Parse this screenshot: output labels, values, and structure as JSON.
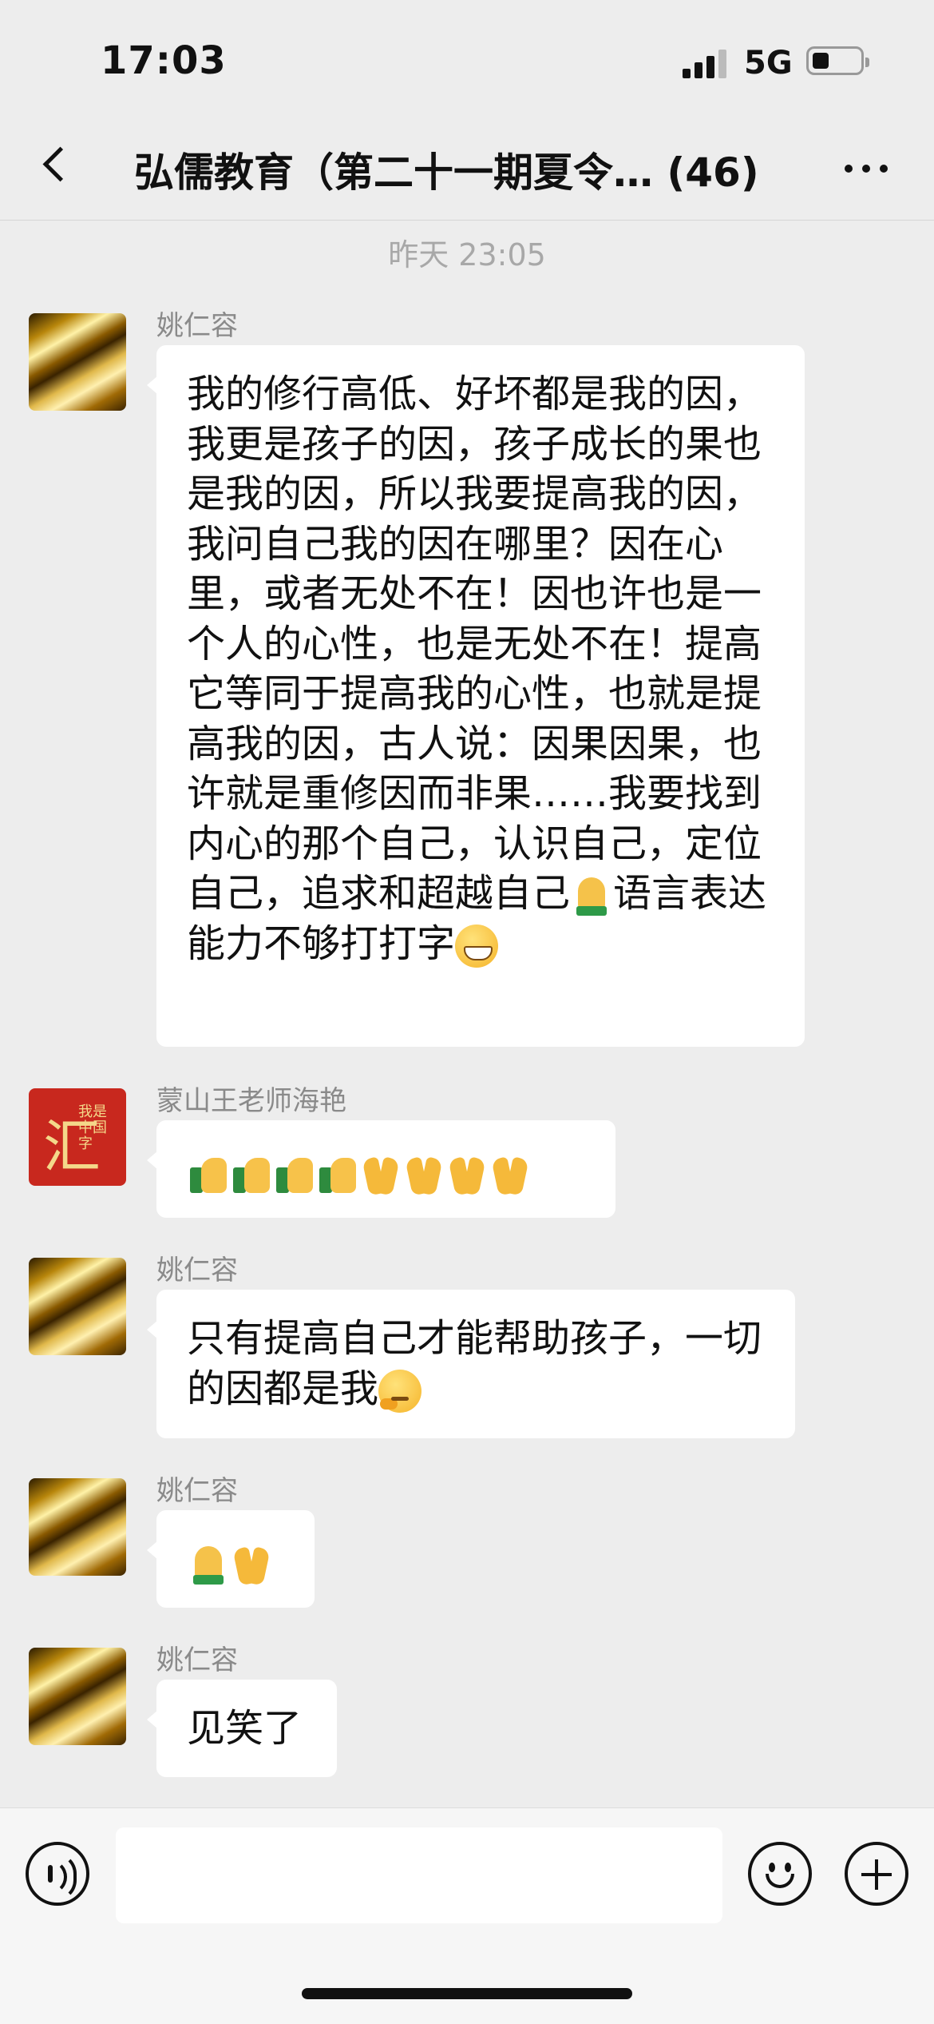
{
  "status_bar": {
    "time": "17:03",
    "network": "5G",
    "signal_icon": "signal-bars-icon",
    "battery_icon": "battery-icon",
    "battery_level": 0.35
  },
  "nav": {
    "back_icon": "chevron-left-icon",
    "title": "弘儒教育（第二十一期夏令… (46)",
    "more_icon": "ellipsis-icon"
  },
  "timestamp": "昨天 23:05",
  "messages": [
    {
      "sender": "姚仁容",
      "avatar": "gold-swirl-avatar",
      "text": "我的修行高低、好坏都是我的因，我更是孩子的因，孩子成长的果也是我的因，所以我要提高我的因，我问自己我的因在哪里？因在心里，或者无处不在！因也许也是一个人的心性，也是无处不在！提高它等同于提高我的心性，也就是提高我的因，古人说：因果因果，也许就是重修因而非果……我要找到内心的那个自己，认识自己，定位自己，追求和超越自己",
      "text_tail": "语言表达能力不够打打字",
      "emoji_inline": "folded-hands-emoji",
      "emoji_end": "grinning-face-emoji"
    },
    {
      "sender": "蒙山王老师海艳",
      "avatar": "red-calligraphy-avatar",
      "avatar_text": "汇",
      "avatar_subtext": "我是中国字",
      "emojis": [
        "thumbs-up-emoji",
        "thumbs-up-emoji",
        "thumbs-up-emoji",
        "thumbs-up-emoji",
        "clapping-hands-emoji",
        "clapping-hands-emoji",
        "clapping-hands-emoji",
        "clapping-hands-emoji"
      ]
    },
    {
      "sender": "姚仁容",
      "avatar": "gold-swirl-avatar",
      "text": "只有提高自己才能帮助孩子，一切的因都是我",
      "emoji_end": "thinking-face-emoji"
    },
    {
      "sender": "姚仁容",
      "avatar": "gold-swirl-avatar",
      "emojis": [
        "folded-hands-emoji",
        "clapping-hands-emoji"
      ]
    },
    {
      "sender": "姚仁容",
      "avatar": "gold-swirl-avatar",
      "text": "见笑了"
    }
  ],
  "input_bar": {
    "voice_icon": "voice-icon",
    "emoji_icon": "smiley-icon",
    "plus_icon": "plus-icon"
  }
}
